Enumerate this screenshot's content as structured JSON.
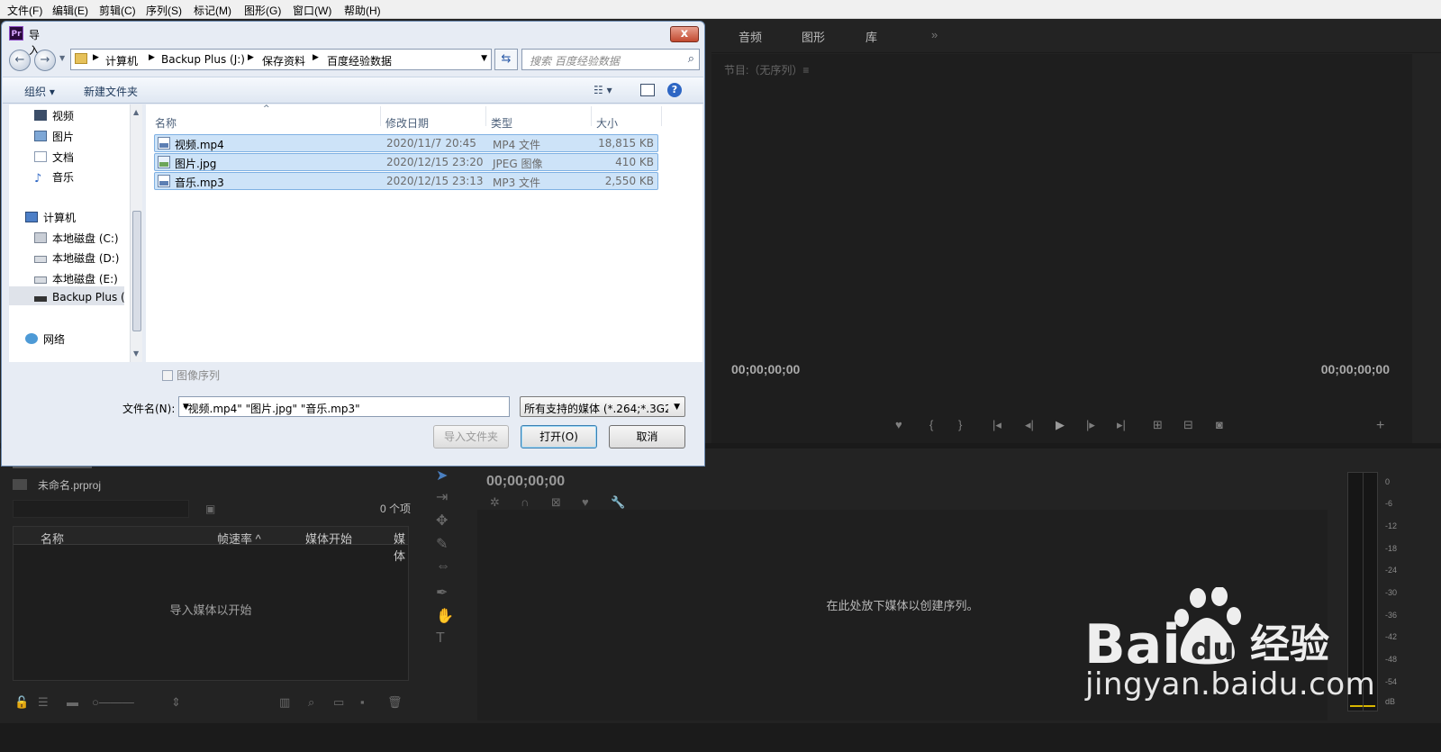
{
  "menubar": [
    "文件(F)",
    "编辑(E)",
    "剪辑(C)",
    "序列(S)",
    "标记(M)",
    "图形(G)",
    "窗口(W)",
    "帮助(H)"
  ],
  "workspace_tabs": [
    "音频",
    "图形",
    "库",
    "»"
  ],
  "program_monitor": {
    "title": "节目:（无序列）≡",
    "timecode_left": "00;00;00;00",
    "timecode_right": "00;00;00;00"
  },
  "project_panel": {
    "file_name": "未命名.prproj",
    "item_count": "0 个项",
    "columns": [
      "名称",
      "帧速率 ^",
      "媒体开始",
      "媒体"
    ],
    "empty_message": "导入媒体以开始"
  },
  "timeline": {
    "timecode": "00;00;00;00",
    "drop_message": "在此处放下媒体以创建序列。"
  },
  "audio_meter": {
    "labels": [
      "0",
      "-6",
      "-12",
      "-18",
      "-24",
      "-30",
      "-36",
      "-42",
      "-48",
      "-54",
      "dB"
    ]
  },
  "dialog": {
    "title": "导入",
    "close": "x",
    "breadcrumb": [
      "计算机",
      "Backup Plus (J:)",
      "保存资料",
      "百度经验数据"
    ],
    "search_placeholder": "搜索 百度经验数据",
    "organize": "组织 ▾",
    "new_folder": "新建文件夹",
    "help": "?",
    "nav": {
      "favorites": [
        "视频",
        "图片",
        "文档",
        "音乐"
      ],
      "computer": "计算机",
      "drives": [
        "本地磁盘 (C:)",
        "本地磁盘 (D:)",
        "本地磁盘 (E:)",
        "Backup Plus ("
      ],
      "network": "网络"
    },
    "columns": [
      "名称",
      "修改日期",
      "类型",
      "大小"
    ],
    "files": [
      {
        "name": "视频.mp4",
        "date": "2020/11/7 20:45",
        "type": "MP4 文件",
        "size": "18,815 KB"
      },
      {
        "name": "图片.jpg",
        "date": "2020/12/15 23:20",
        "type": "JPEG 图像",
        "size": "410 KB"
      },
      {
        "name": "音乐.mp3",
        "date": "2020/12/15 23:13",
        "type": "MP3 文件",
        "size": "2,550 KB"
      }
    ],
    "image_sequence": "图像序列",
    "filename_label": "文件名(N):",
    "filename_value": "\"视频.mp4\" \"图片.jpg\" \"音乐.mp3\"",
    "filetype": "所有支持的媒体 (*.264;*.3G2;*",
    "import_folder": "导入文件夹",
    "open": "打开(O)",
    "cancel": "取消"
  },
  "watermark": {
    "logo": "Baidu 经验",
    "url": "jingyan.baidu.com"
  },
  "colors": {
    "panel_bg": "#232323",
    "dialog_bg": "#e7ecf4",
    "selection": "#cde3f8"
  }
}
